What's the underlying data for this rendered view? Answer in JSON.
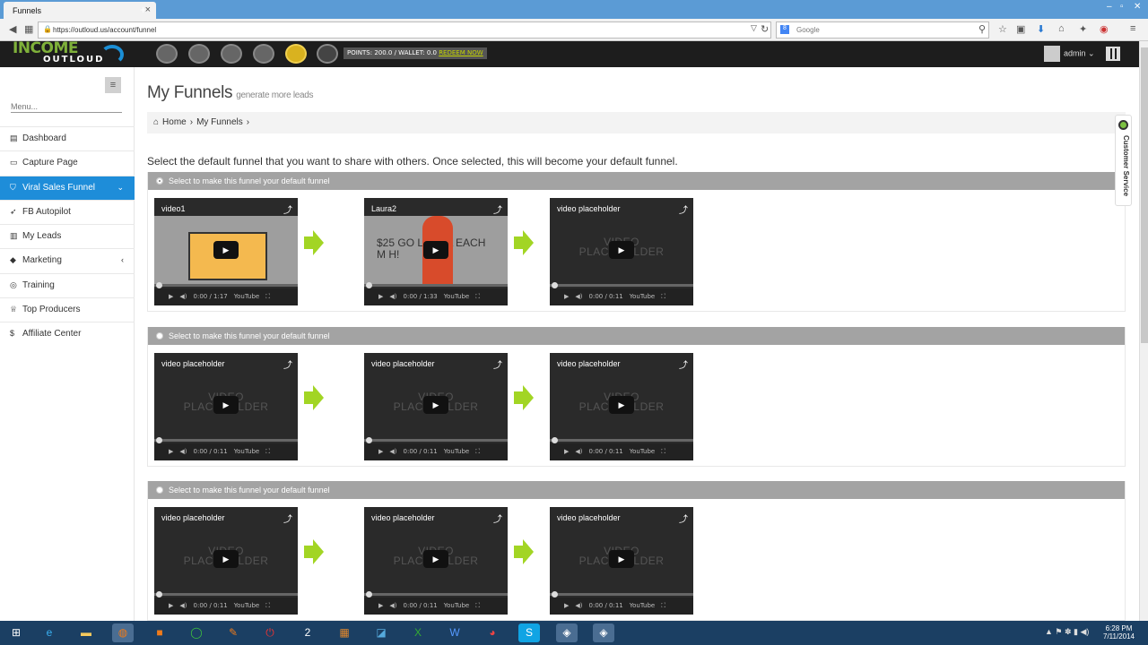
{
  "browser": {
    "tab_title": "Funnels",
    "url": "https://outloud.us/account/funnel",
    "search_placeholder": "Google"
  },
  "site": {
    "logo_top": "INCOME",
    "logo_bottom": "OUTLOUD",
    "points_text": "POINTS: 200.0 / WALLET: 0.0 ",
    "redeem_label": "REDEEM NOW",
    "user_name": "admin"
  },
  "sidebar": {
    "search_placeholder": "Menu...",
    "items": [
      {
        "label": "Dashboard",
        "icon": "dashboard-icon"
      },
      {
        "label": "Capture Page",
        "icon": "laptop-icon"
      },
      {
        "label": "Viral Sales Funnel",
        "icon": "shield-icon"
      },
      {
        "label": "FB Autopilot",
        "icon": "rocket-icon"
      },
      {
        "label": "My Leads",
        "icon": "chart-icon"
      },
      {
        "label": "Marketing",
        "icon": "tag-icon"
      },
      {
        "label": "Training",
        "icon": "play-circle-icon"
      },
      {
        "label": "Top Producers",
        "icon": "trophy-icon"
      },
      {
        "label": "Affiliate Center",
        "icon": "dollar-icon"
      }
    ]
  },
  "main": {
    "title": "My Funnels",
    "subtitle": "generate more leads",
    "breadcrumb": [
      "Home",
      "My Funnels"
    ],
    "instruction": "Select the default funnel that you want to share with others. Once selected, this will become your default funnel.",
    "funnel_label": "Select to make this funnel your default funnel",
    "funnels": [
      {
        "selected": true,
        "videos": [
          {
            "title": "video1",
            "time": "0:00 / 1:17"
          },
          {
            "title": "Laura2",
            "time": "0:00 / 1:33",
            "thumb_text": "$25 GO    LAURA EACH M   H!"
          },
          {
            "title": "video placeholder",
            "time": "0:00 / 0:11"
          }
        ]
      },
      {
        "selected": false,
        "videos": [
          {
            "title": "video placeholder",
            "time": "0:00 / 0:11"
          },
          {
            "title": "video placeholder",
            "time": "0:00 / 0:11"
          },
          {
            "title": "video placeholder",
            "time": "0:00 / 0:11"
          }
        ]
      },
      {
        "selected": false,
        "videos": [
          {
            "title": "video placeholder",
            "time": "0:00 / 0:11"
          },
          {
            "title": "video placeholder",
            "time": "0:00 / 0:11"
          },
          {
            "title": "video placeholder",
            "time": "0:00 / 0:11"
          }
        ]
      }
    ],
    "placeholder_line1": "VIDEO",
    "placeholder_line2": "PLACEHOLDER",
    "youtube_label": "YouTube"
  },
  "customer_service": "Customer Service",
  "taskbar": {
    "time": "6:28 PM",
    "date": "7/11/2014"
  },
  "colors": {
    "accent": "#1e8dd9",
    "arrow": "#a2d524",
    "header": "#1d1d1d",
    "funnel_bar": "#a3a3a3"
  }
}
